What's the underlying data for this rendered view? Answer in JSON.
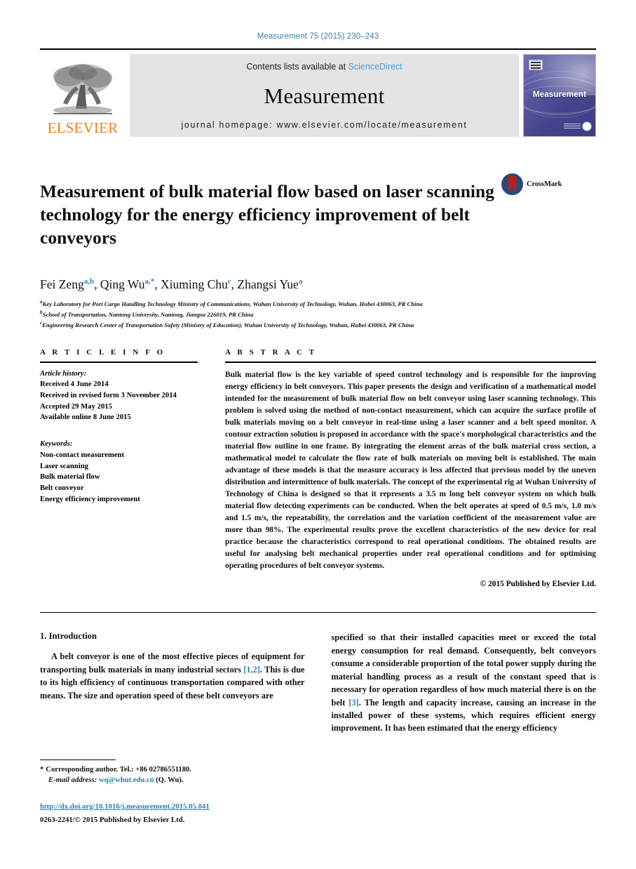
{
  "running_head": "Measurement 75 (2015) 230–243",
  "masthead": {
    "publisher_name": "ELSEVIER",
    "contents_prefix": "Contents lists available at",
    "sciencedirect_link": "ScienceDirect",
    "journal_title": "Measurement",
    "homepage": "journal homepage: www.elsevier.com/locate/measurement",
    "cover_title": "Measurement"
  },
  "article": {
    "title": "Measurement of bulk material flow based on laser scanning technology for the energy efficiency improvement of belt conveyors",
    "crossmark_label": "CrossMark",
    "authors": [
      {
        "name": "Fei Zeng",
        "sup": "a,b",
        "sep": ", "
      },
      {
        "name": "Qing Wu",
        "sup": "a,*",
        "sep": ", "
      },
      {
        "name": "Xiuming Chu",
        "sup": "c",
        "sep": ", "
      },
      {
        "name": "Zhangsi Yue",
        "sup": "a",
        "sep": ""
      }
    ],
    "affiliations": [
      {
        "marker": "a",
        "text": "Key Laboratory for Port Cargo Handling Technology Ministry of Communications, Wuhan University of Technology, Wuhan, Hubei 430063, PR China"
      },
      {
        "marker": "b",
        "text": "School of Transportation, Nantong University, Nantong, Jiangsu 226019, PR China"
      },
      {
        "marker": "c",
        "text": "Engineering Research Center of Transportation Safety (Ministry of Education), Wuhan University of Technology, Wuhan, Hubei 430063, PR China"
      }
    ]
  },
  "article_info": {
    "heading": "A R T I C L E   I N F O",
    "history_label": "Article history:",
    "history": [
      "Received 4 June 2014",
      "Received in revised form 3 November 2014",
      "Accepted 29 May 2015",
      "Available online 8 June 2015"
    ],
    "keywords_label": "Keywords:",
    "keywords": [
      "Non-contact measurement",
      "Laser scanning",
      "Bulk material flow",
      "Belt conveyor",
      "Energy efficiency improvement"
    ]
  },
  "abstract": {
    "heading": "A B S T R A C T",
    "text": "Bulk material flow is the key variable of speed control technology and is responsible for the improving energy efficiency in belt conveyors. This paper presents the design and verification of a mathematical model intended for the measurement of bulk material flow on belt conveyor using laser scanning technology. This problem is solved using the method of non-contact measurement, which can acquire the surface profile of bulk materials moving on a belt conveyor in real-time using a laser scanner and a belt speed monitor. A contour extraction solution is proposed in accordance with the space's morphological characteristics and the material flow outline in one frame. By integrating the element areas of the bulk material cross section, a mathematical model to calculate the flow rate of bulk materials on moving belt is established. The main advantage of these models is that the measure accuracy is less affected that previous model by the uneven distribution and intermittence of bulk materials. The concept of the experimental rig at Wuhan University of Technology of China is designed so that it represents a 3.5 m long belt conveyor system on which bulk material flow detecting experiments can be conducted. When the belt operates at speed of 0.5 m/s, 1.0 m/s and 1.5 m/s, the repeatability, the correlation and the variation coefficient of the measurement value are more than 98%. The experimental results prove the excellent characteristics of the new device for real practice because the characteristics correspond to real operational conditions. The obtained results are useful for analysing belt mechanical properties under real operational conditions and for optimising operating procedures of belt conveyor systems.",
    "copyright": "© 2015 Published by Elsevier Ltd."
  },
  "body": {
    "section_heading": "1. Introduction",
    "left_paragraph_part1": "A belt conveyor is one of the most effective pieces of equipment for transporting bulk materials in many industrial sectors ",
    "left_citation_1": "[1,2]",
    "left_paragraph_part2": ". This is due to its high efficiency of continuous transportation compared with other means. The size and operation speed of these belt conveyors are",
    "right_paragraph_part1": "specified so that their installed capacities meet or exceed the total energy consumption for real demand. Consequently, belt conveyors consume a considerable proportion of the total power supply during the material handling process as a result of the constant speed that is necessary for operation regardless of how much material there is on the belt ",
    "right_citation_1": "[3]",
    "right_paragraph_part2": ". The length and capacity increase, causing an increase in the installed power of these systems, which requires efficient energy improvement. It has been estimated that the energy efficiency"
  },
  "footnotes": {
    "corresponding_star": "*",
    "corresponding_text": "Corresponding author. Tel.: +86 02786551180.",
    "email_label": "E-mail address:",
    "email": "wq@whut.edu.cn",
    "email_owner": "(Q. Wu).",
    "doi": "http://dx.doi.org/10.1016/j.measurement.2015.05.041",
    "issn": "0263-2241/© 2015 Published by Elsevier Ltd."
  },
  "colors": {
    "link_blue": "#2d7fb0",
    "sciencedirect_blue": "#4a9fd4",
    "elsevier_orange": "#ef7f1a",
    "cover_purple": "#55559c",
    "crossmark_red": "#b5211b"
  }
}
